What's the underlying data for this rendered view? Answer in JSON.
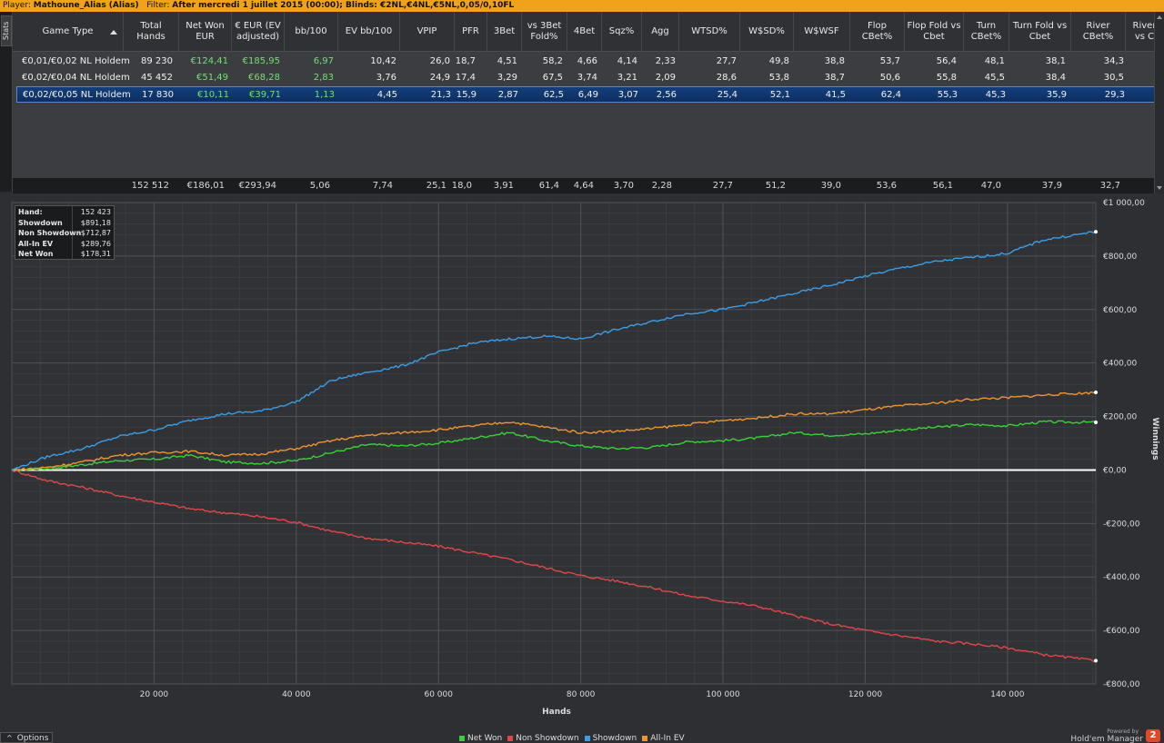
{
  "topbar": {
    "player_label": "Player:",
    "player_value": "Mathoune_Alias (Alias)",
    "filter_label": "Filter:",
    "filter_value": "After mercredi 1 juillet 2015 (00:00); Blinds: €2NL,€4NL,€5NL,0,05/0,10FL"
  },
  "sidestrip": {
    "tab_label": "Stats"
  },
  "table": {
    "headers": [
      "Game Type",
      "Total Hands",
      "Net Won EUR",
      "€ EUR (EV adjusted)",
      "bb/100",
      "EV bb/100",
      "VPIP",
      "PFR",
      "3Bet",
      "vs 3Bet Fold%",
      "4Bet",
      "Sqz%",
      "Agg",
      "WTSD%",
      "W$SD%",
      "W$WSF",
      "Flop CBet%",
      "Flop Fold vs Cbet",
      "Turn CBet%",
      "Turn Fold vs Cbet",
      "River CBet%",
      "River vs C"
    ],
    "rows": [
      [
        "€0,01/€0,02 NL Holdem",
        "89 230",
        "€124,41",
        "€185,95",
        "6,97",
        "10,42",
        "26,0",
        "18,7",
        "4,51",
        "58,2",
        "4,66",
        "4,14",
        "2,33",
        "27,7",
        "49,8",
        "38,8",
        "53,7",
        "56,4",
        "48,1",
        "38,1",
        "34,3"
      ],
      [
        "€0,02/€0,04 NL Holdem",
        "45 452",
        "€51,49",
        "€68,28",
        "2,83",
        "3,76",
        "24,9",
        "17,4",
        "3,29",
        "67,5",
        "3,74",
        "3,21",
        "2,09",
        "28,6",
        "53,8",
        "38,7",
        "50,6",
        "55,8",
        "45,5",
        "38,4",
        "30,5"
      ],
      [
        "€0,02/€0,05 NL Holdem",
        "17 830",
        "€10,11",
        "€39,71",
        "1,13",
        "4,45",
        "21,3",
        "15,9",
        "2,87",
        "62,5",
        "6,49",
        "3,07",
        "2,56",
        "25,4",
        "52,1",
        "41,5",
        "62,4",
        "55,3",
        "45,3",
        "35,9",
        "29,3"
      ]
    ],
    "totals": [
      "",
      "152 512",
      "€186,01",
      "€293,94",
      "5,06",
      "7,74",
      "25,1",
      "18,0",
      "3,91",
      "61,4",
      "4,64",
      "3,70",
      "2,28",
      "27,7",
      "51,2",
      "39,0",
      "53,6",
      "56,1",
      "47,0",
      "37,9",
      "32,7"
    ]
  },
  "infobox": {
    "rows": [
      {
        "k": "Hand:",
        "v": "152 423"
      },
      {
        "k": "Showdown",
        "v": "$891,18"
      },
      {
        "k": "Non Showdown",
        "v": "-$712,87"
      },
      {
        "k": "All-In EV",
        "v": "$289,76"
      },
      {
        "k": "Net Won",
        "v": "$178,31"
      }
    ]
  },
  "colors": {
    "net_won": "#36d436",
    "non_showdown": "#e04848",
    "showdown": "#3a9ee8",
    "allin_ev": "#f0952e",
    "zero_line": "#ffffff",
    "accent": "#f0a21a"
  },
  "chart_data": {
    "type": "line",
    "title": "",
    "xlabel": "Hands",
    "ylabel": "Winnings",
    "xlim": [
      0,
      152423
    ],
    "ylim": [
      -800,
      1000
    ],
    "x_ticks": [
      20000,
      40000,
      60000,
      80000,
      100000,
      120000,
      140000
    ],
    "x_tick_labels": [
      "20 000",
      "40 000",
      "60 000",
      "80 000",
      "100 000",
      "120 000",
      "140 000"
    ],
    "y_ticks": [
      1000,
      800,
      600,
      400,
      200,
      0,
      -200,
      -400,
      -600,
      -800
    ],
    "y_tick_labels": [
      "€1 000,00",
      "€800,00",
      "€600,00",
      "€400,00",
      "€200,00",
      "€0,00",
      "-€200,00",
      "-€400,00",
      "-€600,00",
      "-€800,00"
    ],
    "grid": true,
    "legend": "bottom",
    "x": [
      0,
      5000,
      10000,
      15000,
      20000,
      25000,
      30000,
      35000,
      40000,
      45000,
      50000,
      55000,
      60000,
      65000,
      70000,
      75000,
      80000,
      85000,
      90000,
      95000,
      100000,
      105000,
      110000,
      115000,
      120000,
      125000,
      130000,
      135000,
      140000,
      145000,
      152423
    ],
    "series": [
      {
        "name": "Net Won",
        "color_key": "net_won",
        "values": [
          0,
          5,
          20,
          35,
          40,
          55,
          30,
          25,
          35,
          65,
          95,
          90,
          100,
          120,
          140,
          110,
          90,
          80,
          85,
          105,
          110,
          120,
          140,
          130,
          135,
          150,
          160,
          170,
          165,
          180,
          178
        ]
      },
      {
        "name": "Non Showdown",
        "color_key": "non_showdown",
        "values": [
          0,
          -40,
          -65,
          -95,
          -120,
          -145,
          -160,
          -175,
          -195,
          -230,
          -255,
          -270,
          -285,
          -310,
          -335,
          -365,
          -395,
          -415,
          -440,
          -470,
          -490,
          -510,
          -545,
          -575,
          -600,
          -620,
          -640,
          -650,
          -665,
          -690,
          -713
        ]
      },
      {
        "name": "Showdown",
        "color_key": "showdown",
        "values": [
          0,
          50,
          80,
          125,
          150,
          185,
          210,
          220,
          255,
          335,
          365,
          390,
          440,
          475,
          490,
          500,
          490,
          525,
          555,
          585,
          600,
          630,
          660,
          690,
          725,
          755,
          780,
          795,
          810,
          860,
          891
        ]
      },
      {
        "name": "All-In EV",
        "color_key": "allin_ev",
        "values": [
          0,
          10,
          30,
          55,
          65,
          70,
          55,
          60,
          80,
          110,
          130,
          140,
          150,
          165,
          180,
          160,
          140,
          145,
          155,
          170,
          185,
          195,
          210,
          210,
          225,
          240,
          250,
          265,
          270,
          280,
          290
        ]
      }
    ]
  },
  "bottom": {
    "options_label": "Options",
    "powered_by": "Powered by",
    "brand_name": "Hold'em Manager",
    "brand_badge": "2"
  }
}
